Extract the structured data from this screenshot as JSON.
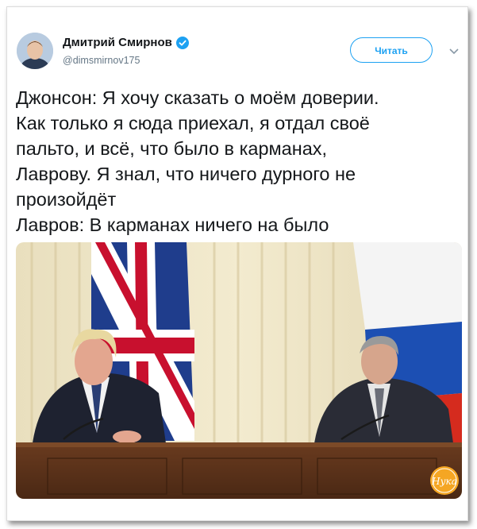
{
  "author": {
    "name": "Дмитрий Смирнов",
    "handle": "@dimsmirnov175"
  },
  "actions": {
    "follow_label": "Читать"
  },
  "icons": {
    "verified": "verified-badge-icon",
    "menu": "chevron-down-icon"
  },
  "tweet": {
    "lines": [
      "Джонсон: Я хочу сказать о моём доверии.",
      "Как только я сюда приехал, я отдал своё",
      "пальто, и всё, что было в карманах,",
      "Лаврову. Я знал, что ничего дурного не",
      "произойдёт",
      "Лавров: В карманах ничего на было"
    ]
  },
  "media": {
    "watermark": "Нука"
  },
  "colors": {
    "accent": "#1da1f2",
    "text": "#14171a",
    "secondary": "#657786"
  }
}
